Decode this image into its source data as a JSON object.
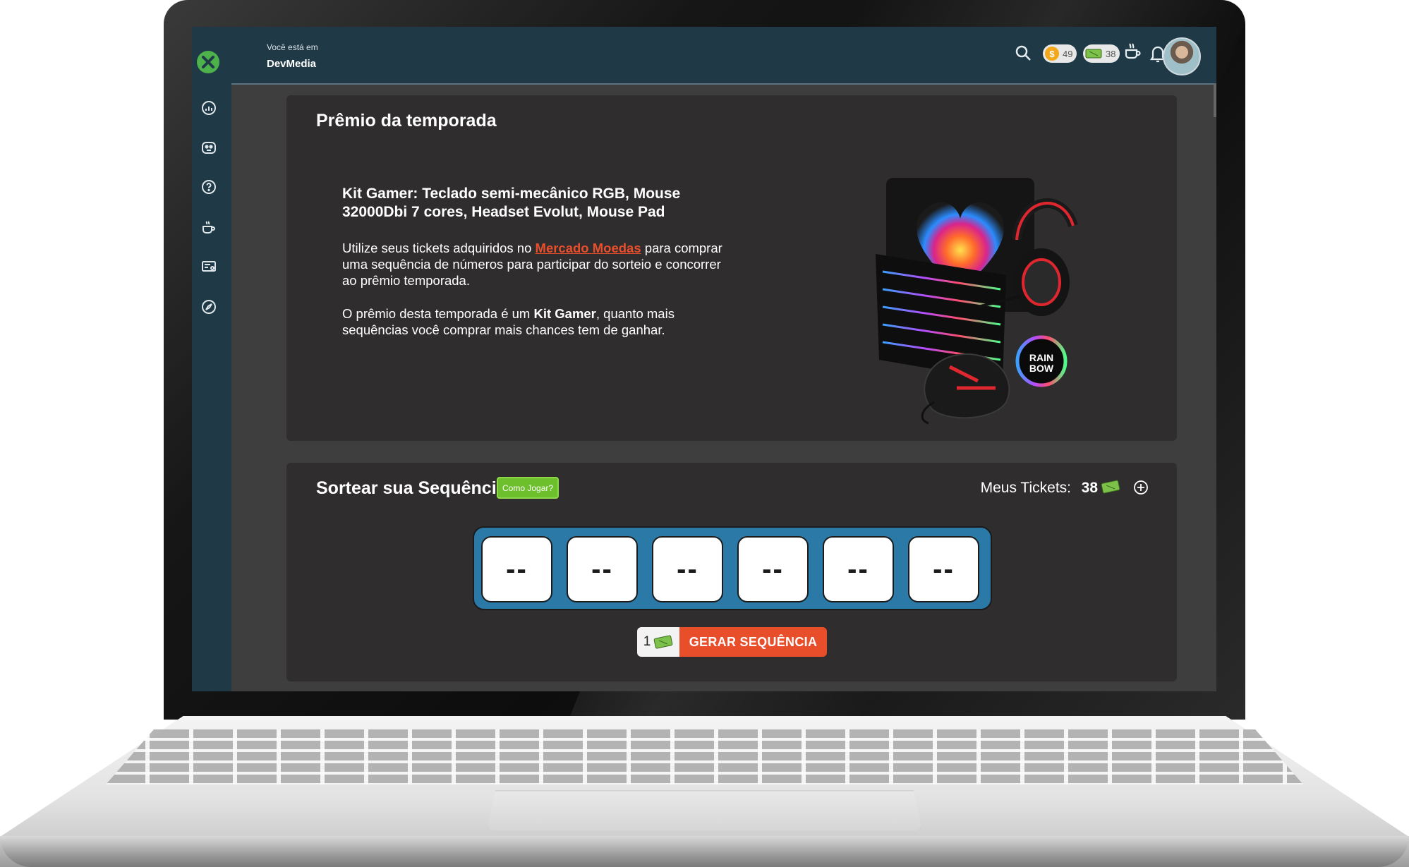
{
  "topbar": {
    "breadcrumb_prefix": "Você está em",
    "site_name": "DevMedia",
    "coins": "49",
    "coin_symbol": "$",
    "tickets": "38"
  },
  "sidebar": {
    "items": [
      {
        "icon": "dashboard-gauge-icon"
      },
      {
        "icon": "robot-face-icon"
      },
      {
        "icon": "question-icon"
      },
      {
        "icon": "coffee-cup-icon"
      },
      {
        "icon": "certificate-icon"
      },
      {
        "icon": "navigation-compass-icon"
      }
    ]
  },
  "prize_card": {
    "title": "Prêmio da temporada",
    "prize_name": "Kit Gamer: Teclado semi-mecânico RGB, Mouse 32000Dbi 7 cores, Headset Evolut, Mouse Pad",
    "p1_before": "Utilize seus tickets adquiridos no ",
    "p1_link": "Mercado Moedas",
    "p1_after": " para comprar uma sequência de números para participar do sorteio e concorrer ao prêmio temporada.",
    "p2_before": "O prêmio desta temporada é um ",
    "p2_bold": "Kit Gamer",
    "p2_after": ", quanto mais sequências você comprar mais chances tem de ganhar.",
    "badge_line1": "RAIN",
    "badge_line2": "BOW"
  },
  "draw_card": {
    "title": "Sortear sua Sequência",
    "help_button": "Como Jogar?",
    "tickets_label": "Meus Tickets:",
    "tickets_count": "38",
    "slots": [
      "--",
      "--",
      "--",
      "--",
      "--",
      "--"
    ],
    "cost": "1",
    "generate_button": "GERAR SEQUÊNCIA"
  },
  "colors": {
    "sidebar": "#1f3a46",
    "card": "#2f2d2d",
    "accent_orange": "#e94e2b",
    "help_green": "#6dbf2c",
    "sequence_blue": "#2a79a6",
    "coin": "#f2a81a"
  }
}
